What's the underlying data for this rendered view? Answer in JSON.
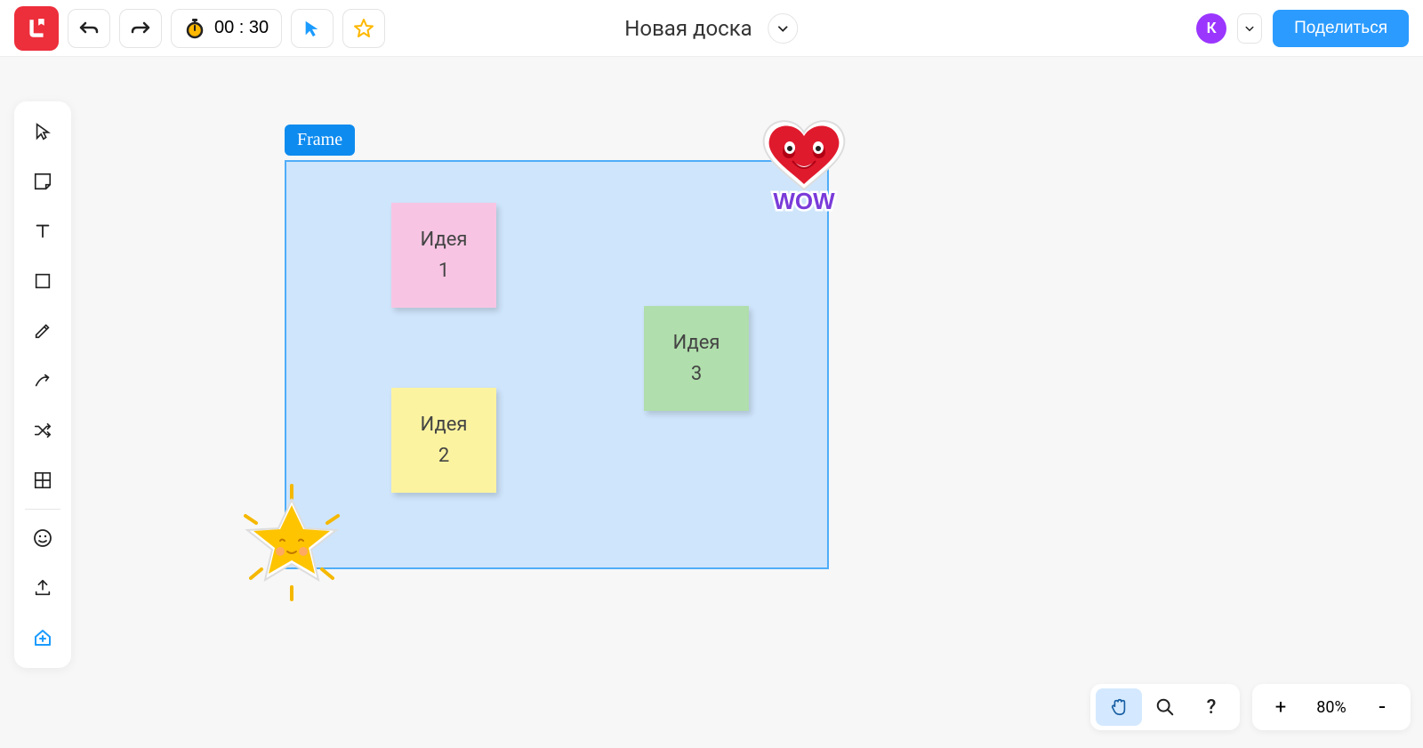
{
  "header": {
    "board_title": "Новая доска",
    "timer": "00 : 30",
    "share_label": "Поделиться",
    "avatar_initial": "К"
  },
  "frame": {
    "label": "Frame"
  },
  "notes": {
    "note1_l1": "Идея",
    "note1_l2": "1",
    "note2_l1": "Идея",
    "note2_l2": "2",
    "note3_l1": "Идея",
    "note3_l2": "3"
  },
  "stickers": {
    "heart_text": "WOW"
  },
  "bottom": {
    "zoom_label": "80%",
    "zoom_in": "+",
    "zoom_out": "-",
    "help": "?"
  },
  "toolbar_icons": {
    "select": "select",
    "note": "note",
    "text": "text",
    "shape": "shape",
    "pen": "pen",
    "connector": "connector",
    "randomize": "randomize",
    "templates": "templates",
    "sticker": "sticker",
    "upload": "upload",
    "add": "add"
  }
}
